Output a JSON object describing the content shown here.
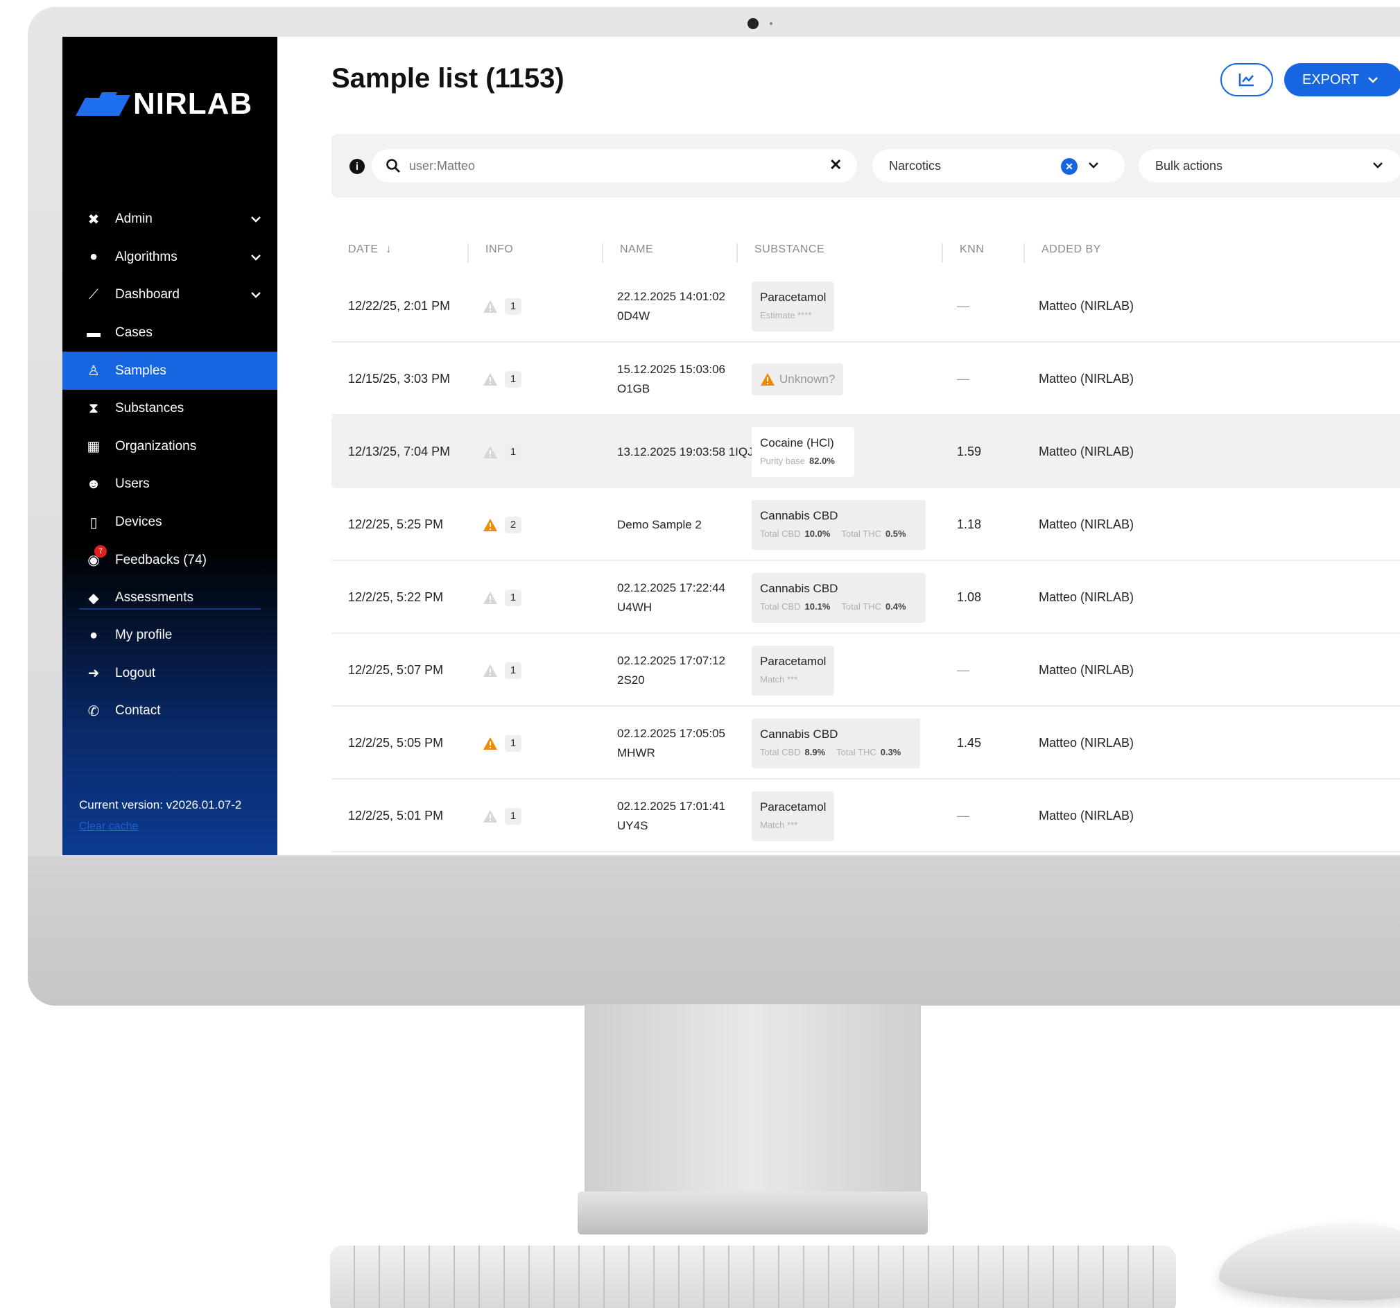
{
  "app": {
    "brand": "NIRLAB",
    "version_text": "Current version: v2026.01.07-2",
    "clear_cache": "Clear cache"
  },
  "sidebar": {
    "items": [
      {
        "label": "Admin",
        "icon": "tools-icon",
        "chevron": true,
        "active": false
      },
      {
        "label": "Algorithms",
        "icon": "brain-icon",
        "chevron": true,
        "active": false
      },
      {
        "label": "Dashboard",
        "icon": "chart-line-icon",
        "chevron": true,
        "active": false
      },
      {
        "label": "Cases",
        "icon": "folder-icon",
        "chevron": false,
        "active": false
      },
      {
        "label": "Samples",
        "icon": "flask-icon",
        "chevron": false,
        "active": true
      },
      {
        "label": "Substances",
        "icon": "hourglass-icon",
        "chevron": false,
        "active": false
      },
      {
        "label": "Organizations",
        "icon": "building-icon",
        "chevron": false,
        "active": false
      },
      {
        "label": "Users",
        "icon": "users-icon",
        "chevron": false,
        "active": false
      },
      {
        "label": "Devices",
        "icon": "device-icon",
        "chevron": false,
        "active": false
      },
      {
        "label": "Feedbacks (74)",
        "icon": "comments-icon",
        "chevron": false,
        "active": false,
        "badge": "7"
      },
      {
        "label": "Assessments",
        "icon": "graduation-cap-icon",
        "chevron": false,
        "active": false
      }
    ],
    "secondary": [
      {
        "label": "My profile",
        "icon": "user-icon"
      },
      {
        "label": "Logout",
        "icon": "logout-icon"
      },
      {
        "label": "Contact",
        "icon": "phone-icon"
      }
    ]
  },
  "header": {
    "title": "Sample list (1153)",
    "chart_button_icon": "chart-icon",
    "export_label": "EXPORT"
  },
  "filters": {
    "search_value": "user:Matteo",
    "category_value": "Narcotics",
    "bulk_actions_label": "Bulk actions"
  },
  "table": {
    "columns": [
      "DATE",
      "INFO",
      "NAME",
      "SUBSTANCE",
      "KNN",
      "ADDED BY"
    ],
    "rows": [
      {
        "date": "12/22/25, 2:01 PM",
        "warn": false,
        "info": "1",
        "name1": "22.12.2025 14:01:02",
        "name2": "0D4W",
        "substance": "Paracetamol",
        "meta": "Estimate ****",
        "knn": "—",
        "added_by": "Matteo (NIRLAB)"
      },
      {
        "date": "12/15/25, 3:03 PM",
        "warn": false,
        "info": "1",
        "name1": "15.12.2025 15:03:06",
        "name2": "O1GB",
        "substance": "Unknown?",
        "unknown": true,
        "meta": "",
        "knn": "—",
        "added_by": "Matteo (NIRLAB)"
      },
      {
        "date": "12/13/25, 7:04 PM",
        "warn": false,
        "info": "1",
        "name1": "13.12.2025 19:03:58 1IQJ",
        "name2": "",
        "substance": "Cocaine (HCl)",
        "meta_label": "Purity base",
        "meta_value": "82.0%",
        "knn": "1.59",
        "added_by": "Matteo (NIRLAB)",
        "highlight": true
      },
      {
        "date": "12/2/25, 5:25 PM",
        "warn": true,
        "info": "2",
        "name1": "Demo Sample 2",
        "name2": "",
        "substance": "Cannabis CBD",
        "cbd": "10.0%",
        "thc": "0.5%",
        "knn": "1.18",
        "added_by": "Matteo (NIRLAB)"
      },
      {
        "date": "12/2/25, 5:22 PM",
        "warn": false,
        "info": "1",
        "name1": "02.12.2025 17:22:44",
        "name2": "U4WH",
        "substance": "Cannabis CBD",
        "cbd": "10.1%",
        "thc": "0.4%",
        "knn": "1.08",
        "added_by": "Matteo (NIRLAB)"
      },
      {
        "date": "12/2/25, 5:07 PM",
        "warn": false,
        "info": "1",
        "name1": "02.12.2025 17:07:12",
        "name2": "2S20",
        "substance": "Paracetamol",
        "meta": "Match ***",
        "knn": "—",
        "added_by": "Matteo (NIRLAB)"
      },
      {
        "date": "12/2/25, 5:05 PM",
        "warn": true,
        "info": "1",
        "name1": "02.12.2025 17:05:05",
        "name2": "MHWR",
        "substance": "Cannabis CBD",
        "cbd": "8.9%",
        "thc": "0.3%",
        "knn": "1.45",
        "added_by": "Matteo (NIRLAB)"
      },
      {
        "date": "12/2/25, 5:01 PM",
        "warn": false,
        "info": "1",
        "name1": "02.12.2025 17:01:41",
        "name2": "UY4S",
        "substance": "Paracetamol",
        "meta": "Match ***",
        "knn": "—",
        "added_by": "Matteo (NIRLAB)"
      }
    ],
    "labels": {
      "total_cbd": "Total CBD",
      "total_thc": "Total THC"
    }
  },
  "colors": {
    "accent": "#1566e0",
    "warning": "#f08a00",
    "sidebar_bg": "#000000"
  }
}
